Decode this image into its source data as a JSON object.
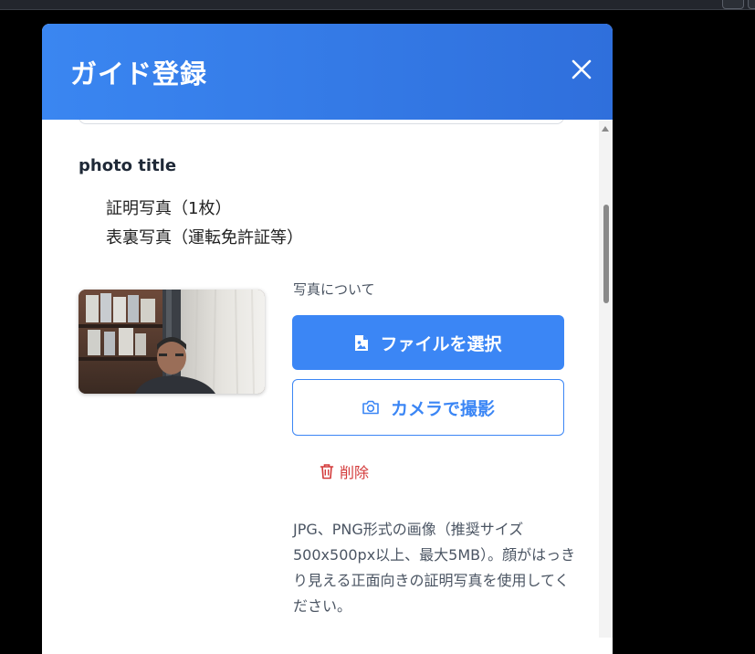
{
  "modal": {
    "title": "ガイド登録"
  },
  "photo_section": {
    "title": "photo title",
    "requirements": [
      "証明写真（1枚）",
      "表裏写真（運転免許証等）"
    ],
    "about_label": "写真について",
    "select_file_label": "ファイルを選択",
    "camera_label": "カメラで撮影",
    "delete_label": "削除",
    "help_text": "JPG、PNG形式の画像（推奨サイズ500x500px以上、最大5MB）。顔がはっきり見える正面向きの証明写真を使用してください。"
  },
  "icons": {
    "close": "close-icon",
    "file_image": "file-image-icon",
    "camera": "camera-icon",
    "trash": "trash-icon"
  },
  "colors": {
    "header_gradient_start": "#3a86f1",
    "header_gradient_end": "#2f6fdc",
    "primary": "#3b86f5",
    "danger": "#d33a3a"
  }
}
